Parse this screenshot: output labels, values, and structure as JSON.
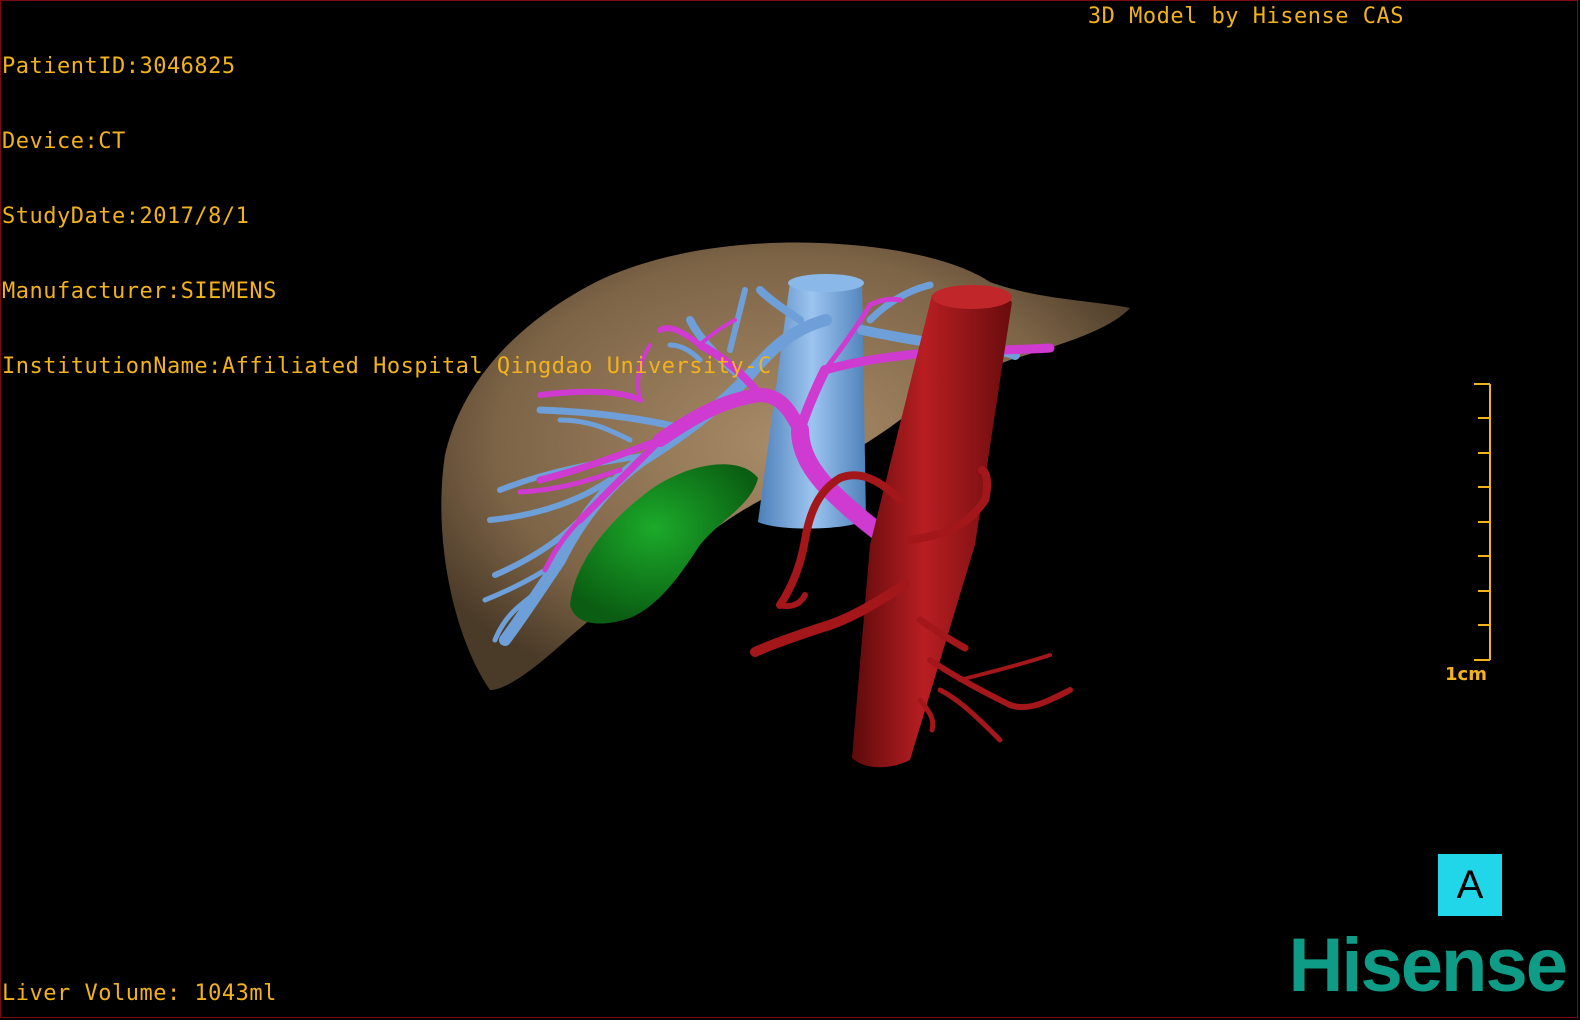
{
  "study_info": {
    "patient_id": "PatientID:3046825",
    "device": "Device:CT",
    "study_date": "StudyDate:2017/8/1",
    "manufacturer": "Manufacturer:SIEMENS",
    "institution": "InstitutionName:Affiliated Hospital Qingdao University-C"
  },
  "credit": "3D Model by Hisense CAS",
  "liver_volume": "Liver Volume: 1043ml",
  "scale_bar": {
    "label": "1cm",
    "ticks": 9
  },
  "orientation_marker": "A",
  "brand": "Hisense",
  "colors": {
    "text": "#f2b21b",
    "liver": "#8a7152",
    "portal_vein": "#cf3ad0",
    "hepatic_vein": "#6f9fd8",
    "inferior_vena_cava": "#7aaee4",
    "aorta": "#a3171a",
    "gallbladder": "#10861a",
    "orientation_bg": "#22d6ea",
    "brand": "#0f9c86"
  },
  "structures": [
    "liver",
    "portal-vein",
    "hepatic-vein",
    "inferior-vena-cava",
    "aorta",
    "gallbladder"
  ]
}
